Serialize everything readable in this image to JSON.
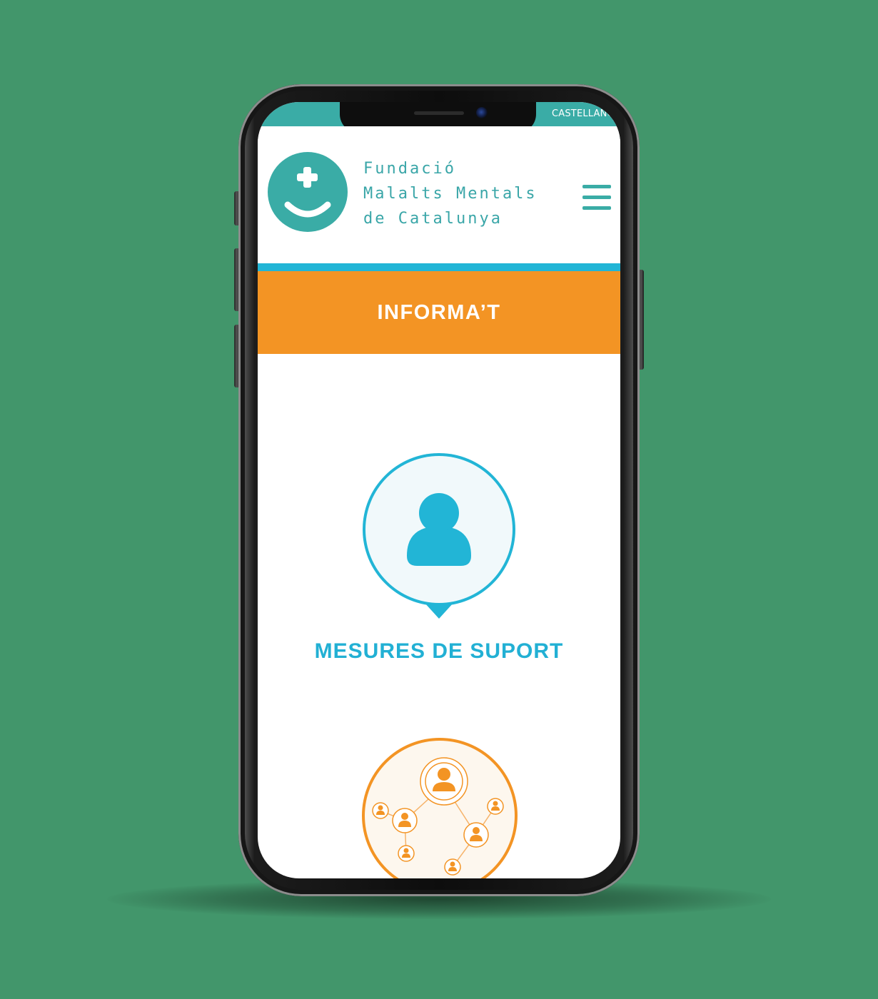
{
  "top_bar": {
    "language_link": "CASTELLANO"
  },
  "header": {
    "logo_icon": "smiley-plus-icon",
    "org_name_lines": [
      "Fundació",
      "Malalts Mentals",
      "de Catalunya"
    ],
    "menu_icon": "hamburger-menu-icon"
  },
  "banner": {
    "title": "INFORMA’T"
  },
  "cards": [
    {
      "title": "MESURES DE SUPORT",
      "icon": "person-icon"
    },
    {
      "icon": "network-people-icon"
    }
  ],
  "colors": {
    "background": "#42966b",
    "teal": "#3aaca6",
    "blue": "#22b5d6",
    "orange": "#f39424"
  }
}
